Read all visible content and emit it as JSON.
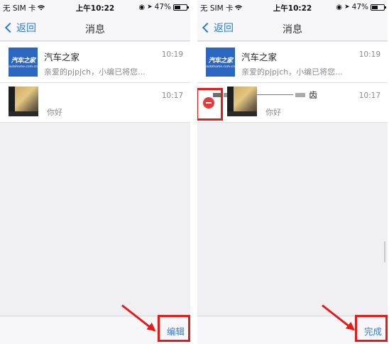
{
  "status_bar": {
    "carrier": "无 SIM 卡",
    "time": "上午10:22",
    "battery": "47%",
    "battery_level": 0.47
  },
  "nav": {
    "back_label": "返回",
    "title": "消息"
  },
  "conversations": [
    {
      "name": "汽车之家",
      "preview": "亲爱的pjpjch，小编已将您...",
      "time": "10:19",
      "logo_main": "汽车之家",
      "logo_sub": "autohome.com.cn"
    },
    {
      "name": "",
      "preview": "你好",
      "time": "10:17",
      "redacted_tail": "齿"
    }
  ],
  "toolbar": {
    "edit_label": "编辑",
    "done_label": "完成"
  },
  "colors": {
    "accent": "#2f7ad8",
    "annotation": "#e21b1b",
    "delete": "#e63b3b",
    "brand": "#2b67c0"
  }
}
